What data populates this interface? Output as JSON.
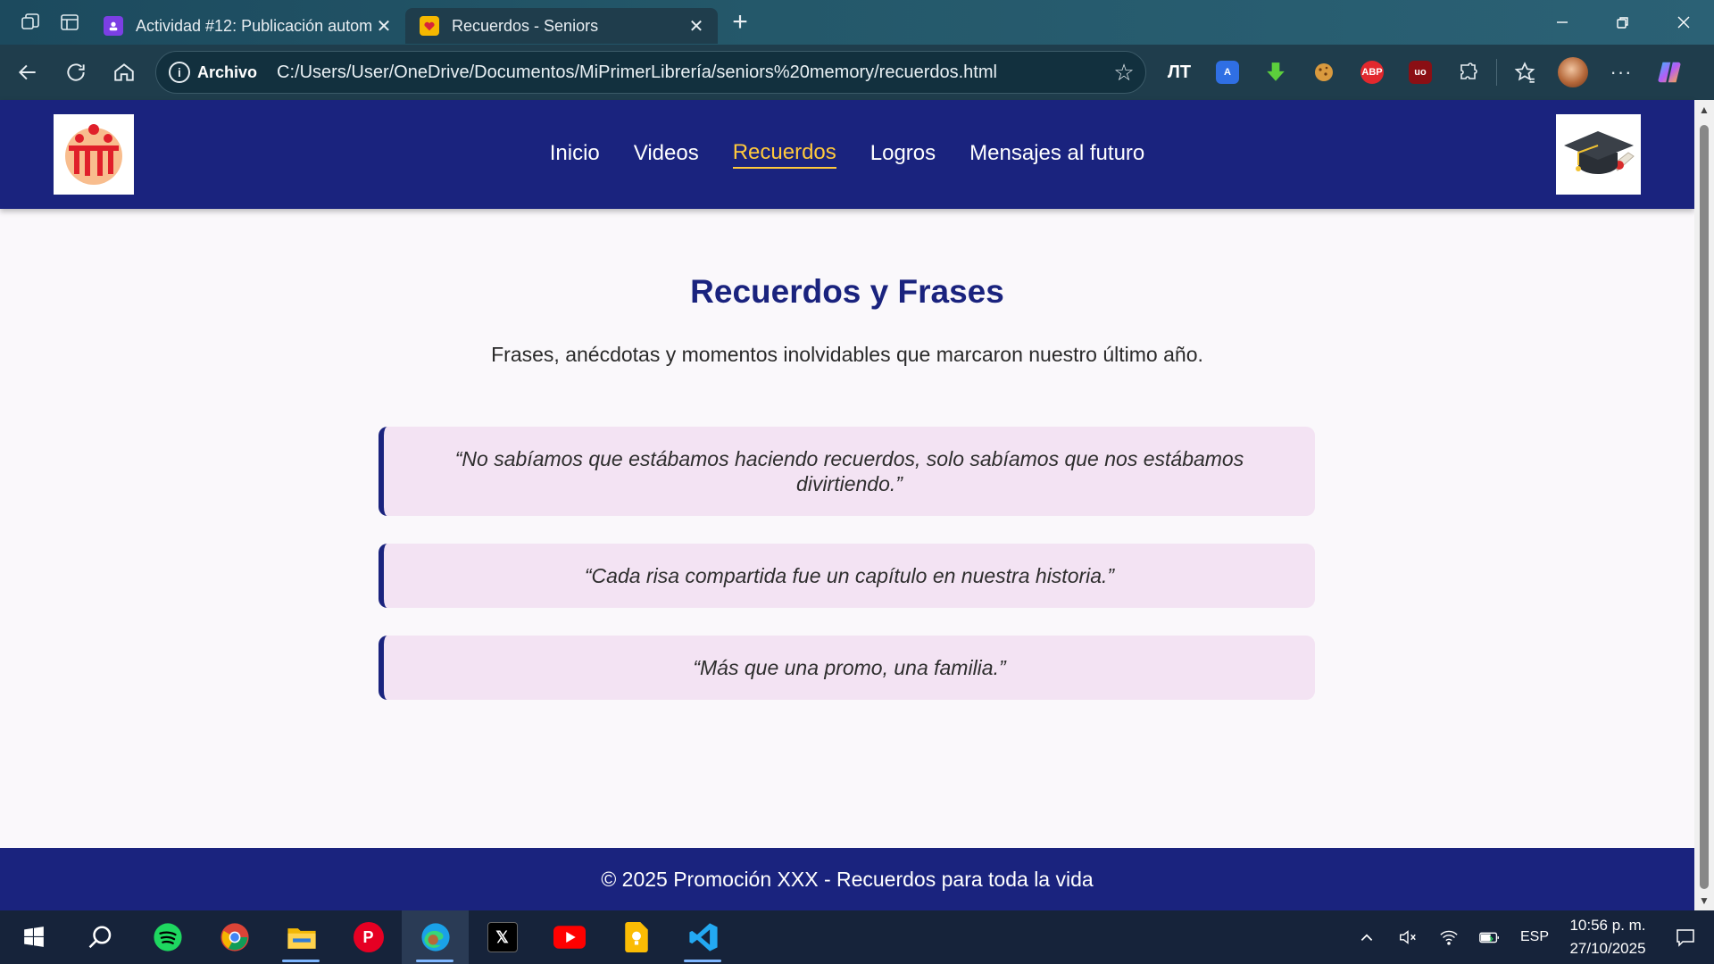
{
  "browser": {
    "tabs": [
      {
        "title": "Actividad #12: Publicación autom",
        "active": false
      },
      {
        "title": "Recuerdos - Seniors",
        "active": true
      }
    ],
    "address": {
      "scheme_label": "Archivo",
      "url": "C:/Users/User/OneDrive/Documentos/MiPrimerLibrería/seniors%20memory/recuerdos.html"
    },
    "extensions": [
      {
        "name": "immersive-translate-icon",
        "label": "ЛТ"
      },
      {
        "name": "translate-icon",
        "label": "A"
      },
      {
        "name": "download-icon",
        "label": ""
      },
      {
        "name": "cookie-icon",
        "label": ""
      },
      {
        "name": "adblock-plus-icon",
        "label": "ABP"
      },
      {
        "name": "ublock-icon",
        "label": "uo"
      }
    ]
  },
  "site": {
    "nav": {
      "items": [
        {
          "label": "Inicio",
          "current": false
        },
        {
          "label": "Videos",
          "current": false
        },
        {
          "label": "Recuerdos",
          "current": true
        },
        {
          "label": "Logros",
          "current": false
        },
        {
          "label": "Mensajes al futuro",
          "current": false
        }
      ]
    },
    "title": "Recuerdos y Frases",
    "subtitle": "Frases, anécdotas y momentos inolvidables que marcaron nuestro último año.",
    "quotes": [
      "“No sabíamos que estábamos haciendo recuerdos, solo sabíamos que nos estábamos divirtiendo.”",
      "“Cada risa compartida fue un capítulo en nuestra historia.”",
      "“Más que una promo, una familia.”"
    ],
    "footer": "© 2025 Promoción XXX - Recuerdos para toda la vida",
    "colors": {
      "header_bg": "#1a237e",
      "nav_active": "#ffc93c",
      "quote_bg": "#f3e3f3",
      "quote_border": "#1a237e"
    }
  },
  "taskbar": {
    "apps": [
      "start-icon",
      "search-icon",
      "spotify-icon",
      "chrome-icon",
      "file-explorer-icon",
      "pinterest-icon",
      "edge-icon",
      "x-icon",
      "youtube-icon",
      "keep-icon",
      "vscode-icon"
    ],
    "language": "ESP",
    "time": "10:56 p. m.",
    "date": "27/10/2025"
  }
}
